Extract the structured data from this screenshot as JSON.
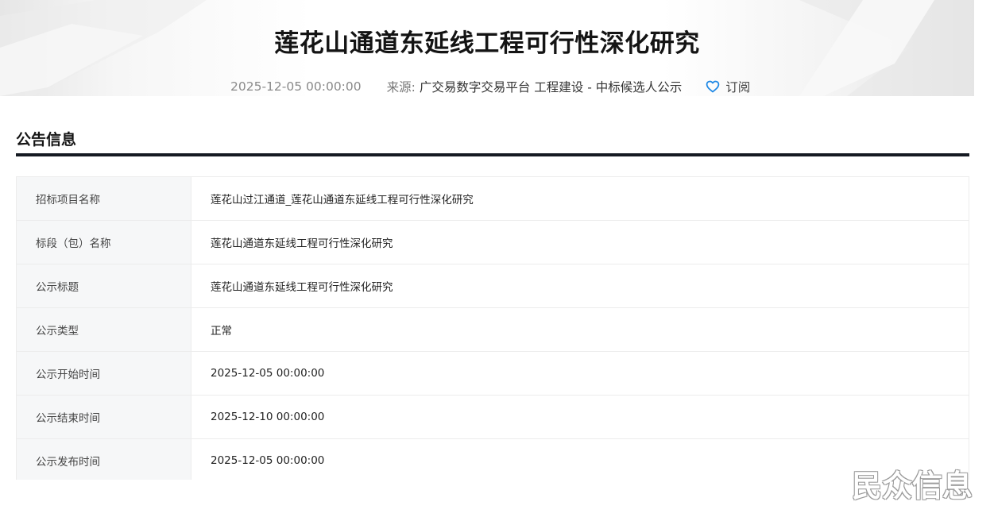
{
  "header": {
    "title": "莲花山通道东延线工程可行性深化研究",
    "date": "2025-12-05 00:00:00",
    "source_label": "来源:",
    "source_value": "广交易数字交易平台 工程建设 - 中标候选人公示",
    "subscribe_label": "订阅",
    "subscribe_icon": "heart-outline-icon",
    "accent_color": "#1e88e5"
  },
  "section": {
    "title": "公告信息"
  },
  "info_rows": [
    {
      "key": "招标项目名称",
      "value": "莲花山过江通道_莲花山通道东延线工程可行性深化研究"
    },
    {
      "key": "标段（包）名称",
      "value": "莲花山通道东延线工程可行性深化研究"
    },
    {
      "key": "公示标题",
      "value": "莲花山通道东延线工程可行性深化研究"
    },
    {
      "key": "公示类型",
      "value": "正常"
    },
    {
      "key": "公示开始时间",
      "value": "2025-12-05 00:00:00"
    },
    {
      "key": "公示结束时间",
      "value": "2025-12-10 00:00:00"
    },
    {
      "key": "公示发布时间",
      "value": "2025-12-05 00:00:00"
    }
  ],
  "watermark": {
    "text": "民众信息"
  }
}
